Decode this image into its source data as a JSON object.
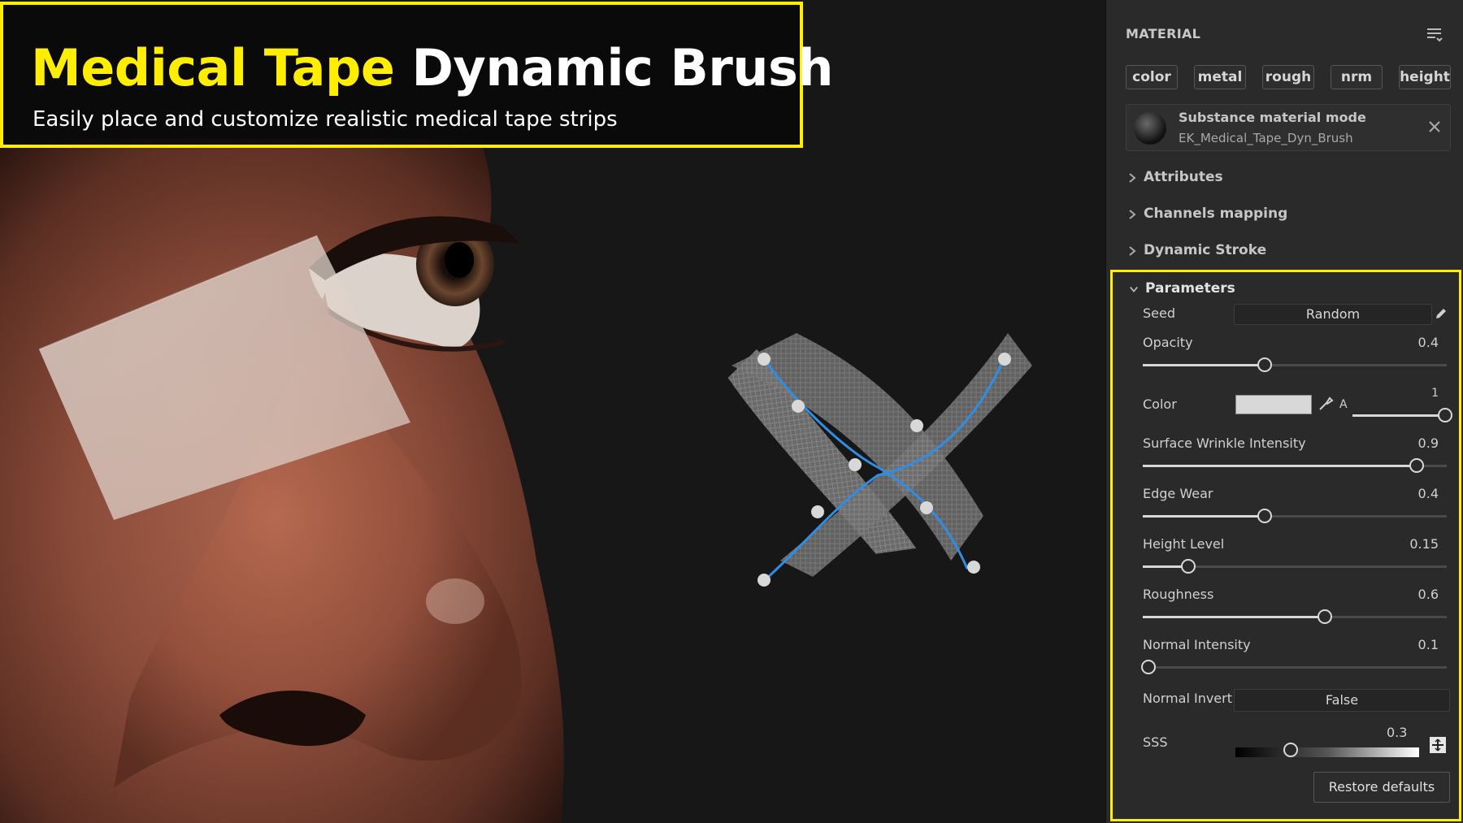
{
  "banner": {
    "title_accent": "Medical Tape",
    "title_main": "Dynamic Brush",
    "subtitle": "Easily place and customize realistic medical tape strips",
    "border_color": "#ffee00"
  },
  "panel": {
    "header": "MATERIAL",
    "channels": [
      "color",
      "metal",
      "rough",
      "nrm",
      "height"
    ],
    "material": {
      "mode": "Substance material mode",
      "name": "EK_Medical_Tape_Dyn_Brush"
    },
    "sections": [
      "Attributes",
      "Channels mapping",
      "Dynamic Stroke"
    ],
    "parameters": {
      "title": "Parameters",
      "seed": {
        "label": "Seed",
        "value": "Random"
      },
      "opacity": {
        "label": "Opacity",
        "value": "0.4",
        "level": 0.4
      },
      "color": {
        "label": "Color",
        "swatch": "#d8d8d8",
        "alpha_label": "A",
        "alpha_value": "1",
        "alpha_level": 1.0
      },
      "surface_wrinkle": {
        "label": "Surface Wrinkle Intensity",
        "value": "0.9",
        "level": 0.9
      },
      "edge_wear": {
        "label": "Edge Wear",
        "value": "0.4",
        "level": 0.4
      },
      "height_level": {
        "label": "Height Level",
        "value": "0.15",
        "level": 0.15
      },
      "roughness": {
        "label": "Roughness",
        "value": "0.6",
        "level": 0.6
      },
      "normal_intensity": {
        "label": "Normal Intensity",
        "value": "0.1",
        "level": 0.02
      },
      "normal_invert": {
        "label": "Normal Invert",
        "value": "False"
      },
      "sss": {
        "label": "SSS",
        "value": "0.3",
        "level": 0.3
      },
      "restore_label": "Restore defaults"
    },
    "highlight_color": "#ffee00"
  },
  "icons": {
    "menu": "list-menu-icon",
    "close": "close-icon",
    "pencil": "pencil-icon",
    "picker": "eyedropper-icon",
    "sss": "texture-pick-icon",
    "chevron_right": "chevron-right-icon",
    "chevron_down": "chevron-down-icon"
  }
}
